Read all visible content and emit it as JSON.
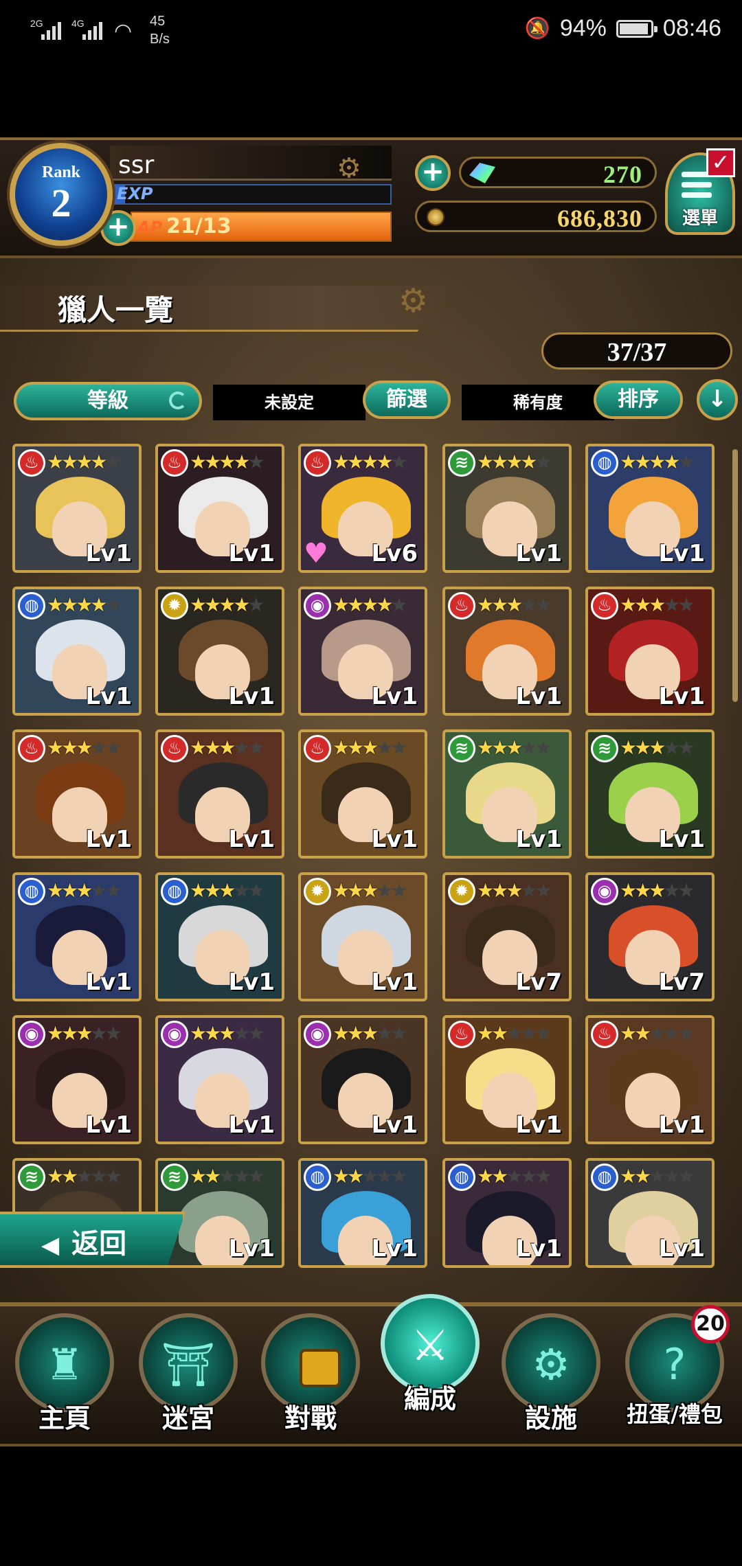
{
  "status_bar": {
    "net1": "2G",
    "net2": "4G",
    "speed_value": "45",
    "speed_unit": "B/s",
    "battery": "94%",
    "time": "08:46",
    "battery_level": 0.94
  },
  "player": {
    "rank_label": "Rank",
    "rank_value": "2",
    "name": "ssr",
    "exp_label": "EXP",
    "exp_fill": 0.05,
    "ap_label": "AP",
    "ap_value": "21/13",
    "ap_fill": 1.0
  },
  "currency": {
    "gems": "270",
    "coins": "686,830"
  },
  "menu": {
    "label": "選單",
    "check": "✓"
  },
  "page": {
    "title": "獵人一覽",
    "count": "37/37"
  },
  "controls": {
    "level_sort": "等級",
    "filter_state": "未設定",
    "filter_button": "篩選",
    "rarity_label": "稀有度",
    "sort_button": "排序",
    "down_icon": "↓"
  },
  "elements": {
    "fire": {
      "color": "#d42a2a",
      "icon": "fire-icon",
      "glyph": "♨"
    },
    "wind": {
      "color": "#2f9a3a",
      "icon": "wind-icon",
      "glyph": "≋"
    },
    "water": {
      "color": "#2a5fd0",
      "icon": "water-icon",
      "glyph": "◍"
    },
    "light": {
      "color": "#c9a314",
      "icon": "light-icon",
      "glyph": "✹"
    },
    "dark": {
      "color": "#9a2fb0",
      "icon": "dark-icon",
      "glyph": "◉"
    }
  },
  "hunters": [
    {
      "element": "fire",
      "stars": 4,
      "level": "Lv1",
      "hair": "#e8c35a",
      "bg": "#3b4048"
    },
    {
      "element": "fire",
      "stars": 4,
      "level": "Lv1",
      "hair": "#eaeaea",
      "bg": "#2b1d22"
    },
    {
      "element": "fire",
      "stars": 4,
      "level": "Lv6",
      "hair": "#f1b52c",
      "bg": "#3a2a3e",
      "favorite": true
    },
    {
      "element": "wind",
      "stars": 4,
      "level": "Lv1",
      "hair": "#9a8057",
      "bg": "#3d3a30"
    },
    {
      "element": "water",
      "stars": 4,
      "level": "Lv1",
      "hair": "#f2a33a",
      "bg": "#2d3d6a"
    },
    {
      "element": "water",
      "stars": 4,
      "level": "Lv1",
      "hair": "#dde3ea",
      "bg": "#32465a"
    },
    {
      "element": "light",
      "stars": 4,
      "level": "Lv1",
      "hair": "#6a4a2a",
      "bg": "#2a2620"
    },
    {
      "element": "dark",
      "stars": 4,
      "level": "Lv1",
      "hair": "#b89a8a",
      "bg": "#3a2a36"
    },
    {
      "element": "fire",
      "stars": 3,
      "level": "Lv1",
      "hair": "#e07a2a",
      "bg": "#4a3a2a"
    },
    {
      "element": "fire",
      "stars": 3,
      "level": "Lv1",
      "hair": "#b32222",
      "bg": "#5a1a14"
    },
    {
      "element": "fire",
      "stars": 3,
      "level": "Lv1",
      "hair": "#7a3a12",
      "bg": "#6a4222"
    },
    {
      "element": "fire",
      "stars": 3,
      "level": "Lv1",
      "hair": "#2a2a2a",
      "bg": "#5a3020"
    },
    {
      "element": "fire",
      "stars": 3,
      "level": "Lv1",
      "hair": "#3a2a1a",
      "bg": "#6a4a22"
    },
    {
      "element": "wind",
      "stars": 3,
      "level": "Lv1",
      "hair": "#e8d88a",
      "bg": "#3a5a3a"
    },
    {
      "element": "wind",
      "stars": 3,
      "level": "Lv1",
      "hair": "#9ad04a",
      "bg": "#2a3a22"
    },
    {
      "element": "water",
      "stars": 3,
      "level": "Lv1",
      "hair": "#1a1a3a",
      "bg": "#2a3a6a"
    },
    {
      "element": "water",
      "stars": 3,
      "level": "Lv1",
      "hair": "#d8d8d8",
      "bg": "#1f3a40"
    },
    {
      "element": "light",
      "stars": 3,
      "level": "Lv1",
      "hair": "#cfd8e0",
      "bg": "#6a4a28"
    },
    {
      "element": "light",
      "stars": 3,
      "level": "Lv7",
      "hair": "#3a2a1a",
      "bg": "#4a3020"
    },
    {
      "element": "dark",
      "stars": 3,
      "level": "Lv7",
      "hair": "#d8502a",
      "bg": "#2a2a2e"
    },
    {
      "element": "dark",
      "stars": 3,
      "level": "Lv1",
      "hair": "#2a1a1a",
      "bg": "#3a2224"
    },
    {
      "element": "dark",
      "stars": 3,
      "level": "Lv1",
      "hair": "#d8d8e0",
      "bg": "#3a2a44"
    },
    {
      "element": "dark",
      "stars": 3,
      "level": "Lv1",
      "hair": "#1a1a1a",
      "bg": "#4a3424"
    },
    {
      "element": "fire",
      "stars": 2,
      "level": "Lv1",
      "hair": "#f5dd8a",
      "bg": "#5a3a1a"
    },
    {
      "element": "fire",
      "stars": 2,
      "level": "Lv1",
      "hair": "#5a3a1a",
      "bg": "#5a3a22"
    },
    {
      "element": "wind",
      "stars": 2,
      "level": "",
      "hair": "#4a3a2a",
      "bg": "#3a3026"
    },
    {
      "element": "wind",
      "stars": 2,
      "level": "Lv1",
      "hair": "#8aa08a",
      "bg": "#2a3a2e"
    },
    {
      "element": "water",
      "stars": 2,
      "level": "Lv1",
      "hair": "#3aa0d8",
      "bg": "#2a3a4a"
    },
    {
      "element": "water",
      "stars": 2,
      "level": "Lv1",
      "hair": "#1a1a2a",
      "bg": "#3a2a3a"
    },
    {
      "element": "water",
      "stars": 2,
      "level": "Lv1",
      "hair": "#e0d0a0",
      "bg": "#3a3a3a"
    }
  ],
  "back_button": {
    "label": "返回",
    "arrow": "◀"
  },
  "nav": [
    {
      "id": "home",
      "label": "主頁",
      "glyph": "♜",
      "icon": "tower-icon"
    },
    {
      "id": "dungeon",
      "label": "迷宮",
      "glyph": "⛩",
      "icon": "gate-icon"
    },
    {
      "id": "battle",
      "label": "對戰",
      "glyph": "",
      "icon": "lock-icon"
    },
    {
      "id": "formation",
      "label": "編成",
      "glyph": "⚔",
      "icon": "party-icon",
      "active": true
    },
    {
      "id": "facility",
      "label": "設施",
      "glyph": "⚙",
      "icon": "gear-icon"
    },
    {
      "id": "gacha",
      "label": "扭蛋/禮包",
      "glyph": "?",
      "icon": "gacha-icon",
      "badge": "20"
    }
  ]
}
